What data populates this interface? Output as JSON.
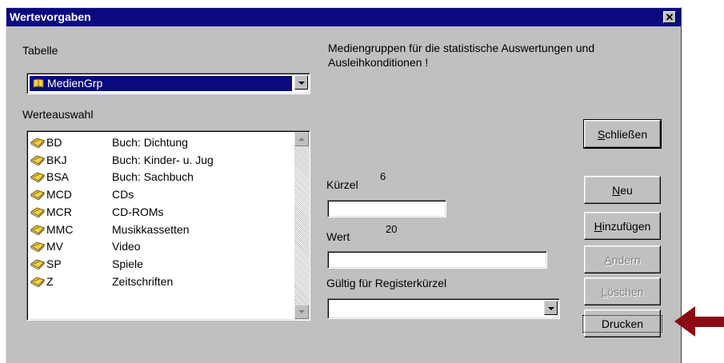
{
  "window": {
    "title": "Wertevorgaben",
    "close_glyph": "✕"
  },
  "tabelle": {
    "label": "Tabelle",
    "selected": "MedienGrp",
    "icon": "open-book-icon"
  },
  "description": "Mediengruppen für die statistische Auswertungen und Ausleihkonditionen !",
  "werteauswahl": {
    "label": "Werteauswahl",
    "items": [
      {
        "code": "BD",
        "desc": "Buch: Dichtung"
      },
      {
        "code": "BKJ",
        "desc": "Buch: Kinder- u. Jug"
      },
      {
        "code": "BSA",
        "desc": "Buch: Sachbuch"
      },
      {
        "code": "MCD",
        "desc": "CDs"
      },
      {
        "code": "MCR",
        "desc": "CD-ROMs"
      },
      {
        "code": "MMC",
        "desc": "Musikkassetten"
      },
      {
        "code": "MV",
        "desc": "Video"
      },
      {
        "code": "SP",
        "desc": "Spiele"
      },
      {
        "code": "Z",
        "desc": "Zeitschriften"
      }
    ]
  },
  "kuerzel": {
    "label": "Kürzel",
    "maxlen": "6",
    "value": ""
  },
  "wert": {
    "label": "Wert",
    "maxlen": "20",
    "value": ""
  },
  "gueltig": {
    "label": "Gültig für Registerkürzel",
    "selected": ""
  },
  "buttons": {
    "schliessen": {
      "accel": "S",
      "rest": "chließen"
    },
    "neu": {
      "accel": "N",
      "rest": "eu"
    },
    "hinzufuegen": {
      "accel": "H",
      "rest": "inzufügen"
    },
    "aendern": {
      "accel": "Ä",
      "rest": "ndern"
    },
    "loeschen": {
      "accel": "L",
      "rest": "öschen"
    },
    "drucken": {
      "label": "Drucken"
    }
  },
  "colors": {
    "face": "#c0c0c0",
    "titlebar": "#0a0a80",
    "arrow": "#8b0a14"
  }
}
